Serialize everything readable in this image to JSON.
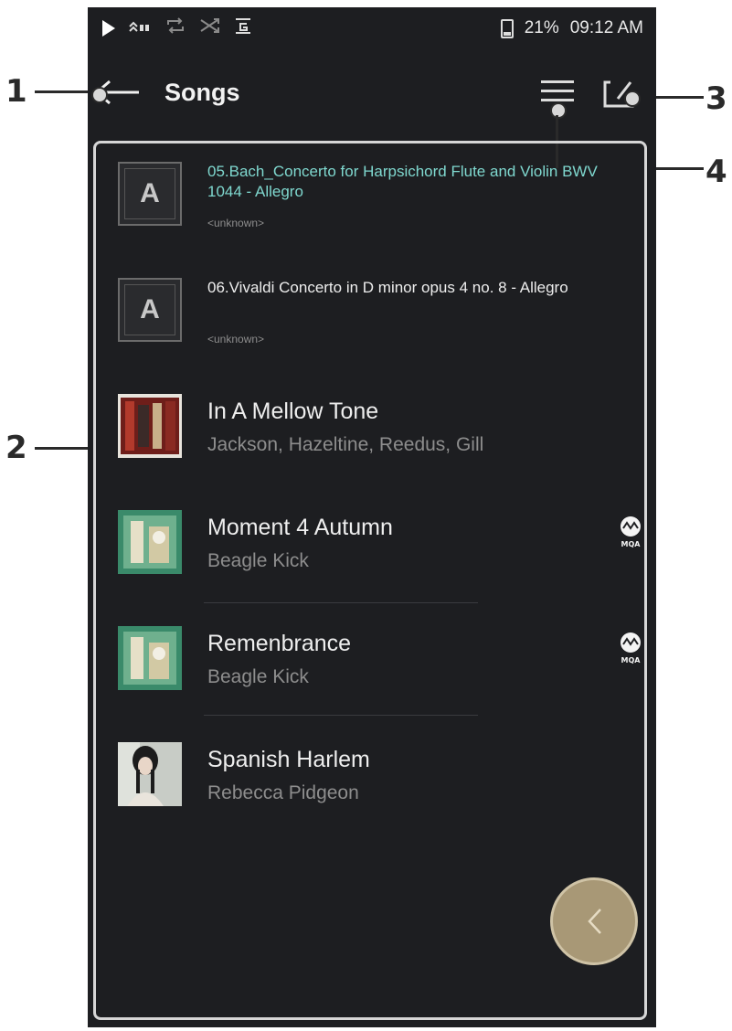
{
  "status_bar": {
    "indicators": [
      "play-icon",
      "hires-icon",
      "repeat-icon",
      "shuffle-icon",
      "gapless-icon"
    ],
    "battery": "21%",
    "time": "09:12 AM"
  },
  "app_bar": {
    "title": "Songs",
    "back_icon": "back-arrow-icon",
    "menu_icon": "menu-icon",
    "edit_icon": "edit-icon"
  },
  "songs": [
    {
      "title": "05.Bach_Concerto for Harpsichord Flute and Violin BWV 1044 - Allegro",
      "artist": "<unknown>",
      "playing": true,
      "art": "astell-default",
      "mqa": false
    },
    {
      "title": "06.Vivaldi Concerto in D minor opus 4 no. 8 - Allegro",
      "artist": "<unknown>",
      "playing": false,
      "art": "astell-default",
      "mqa": false
    },
    {
      "title": "In A Mellow Tone",
      "artist": "Jackson, Hazeltine, Reedus, Gill",
      "playing": false,
      "art": "album-art",
      "mqa": false
    },
    {
      "title": "Moment 4 Autumn",
      "artist": "Beagle Kick",
      "playing": false,
      "art": "album-art",
      "mqa": true,
      "badge": "MQA"
    },
    {
      "title": "Remenbrance",
      "artist": "Beagle Kick",
      "playing": false,
      "art": "album-art",
      "mqa": true,
      "badge": "MQA"
    },
    {
      "title": "Spanish Harlem",
      "artist": "Rebecca Pidgeon",
      "playing": false,
      "art": "album-art",
      "mqa": false
    }
  ],
  "astell_glyph": "A",
  "fab_icon": "chevron-left-icon",
  "callouts": [
    "1",
    "2",
    "3",
    "4"
  ],
  "colors": {
    "background": "#1d1e21",
    "playing_text": "#7fd8cf",
    "fab": "#a89876"
  }
}
